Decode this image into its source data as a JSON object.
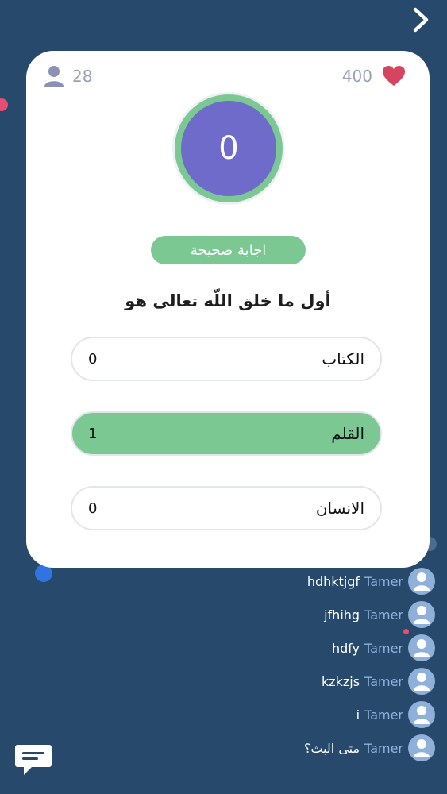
{
  "header": {
    "next_icon": "chevron-right-icon"
  },
  "card": {
    "viewers_count": "28",
    "viewers_icon": "user-icon",
    "likes_count": "400",
    "likes_icon": "heart-icon",
    "timer_value": "0",
    "status_badge": "اجابة صحيحة",
    "question": "أول ما خلق اللّه تعالى هو",
    "options": [
      {
        "label": "الكتاب",
        "votes": "0",
        "correct": false
      },
      {
        "label": "القلم",
        "votes": "1",
        "correct": true
      },
      {
        "label": "الانسان",
        "votes": "0",
        "correct": false
      }
    ]
  },
  "comments": [
    {
      "user": "Tamer",
      "message": "hdhktjgf"
    },
    {
      "user": "Tamer",
      "message": "jfhihg"
    },
    {
      "user": "Tamer",
      "message": "hdfy"
    },
    {
      "user": "Tamer",
      "message": "kzkzjs"
    },
    {
      "user": "Tamer",
      "message": "i"
    },
    {
      "user": "Tamer",
      "message": "متى البث؟"
    }
  ],
  "footer": {
    "chat_icon": "chat-bubble-icon"
  },
  "colors": {
    "background": "#27496b",
    "accent_green": "#7bc893",
    "timer_purple": "#6e6bcb",
    "heart_red": "#d6455f",
    "username_blue": "#8db3e0"
  }
}
